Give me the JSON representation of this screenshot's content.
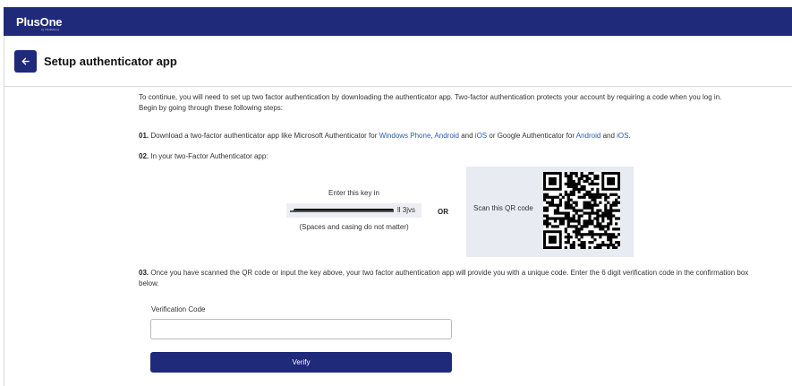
{
  "app": {
    "logo": "PlusOne",
    "logo_sub": "by ThinkMoney"
  },
  "header": {
    "title": "Setup authenticator app"
  },
  "intro": {
    "line1": "To continue, you will need to set up two factor authentication by downloading the authenticator app. Two-factor authentication protects your account by requiring a code when you log in.",
    "line2": "Begin by going through these following steps:"
  },
  "step1": {
    "num": "01.",
    "text_a": " Download a two-factor authenticator app like Microsoft Authenticator for ",
    "link_windows": "Windows Phone",
    "sep1": ", ",
    "link_android_ms": "Android",
    "and1": " and ",
    "link_ios_ms": "iOS",
    "text_b": " or Google Authenticator for ",
    "link_android_g": "Android",
    "and2": " and ",
    "link_ios_g": "iOS",
    "end": "."
  },
  "step2": {
    "num": "02.",
    "text": " In your two-Factor Authenticator app:"
  },
  "key": {
    "label": "Enter this key in",
    "visible_tail": "ll 3jvs",
    "note": "(Spaces and casing do not matter)"
  },
  "or_label": "OR",
  "qr": {
    "label": "Scan this QR code"
  },
  "step3": {
    "num": "03.",
    "text": " Once you have scanned the QR code or input the key above, your two factor authentication app will provide you with a unique code. Enter the 6 digit verification code in the confirmation box below."
  },
  "verification": {
    "label": "Verification Code",
    "value": "",
    "placeholder": ""
  },
  "verify_button": {
    "label": "Verify"
  },
  "colors": {
    "brand": "#1f2a7a",
    "link": "#2d5bb5",
    "panel": "#e9ebf3"
  }
}
